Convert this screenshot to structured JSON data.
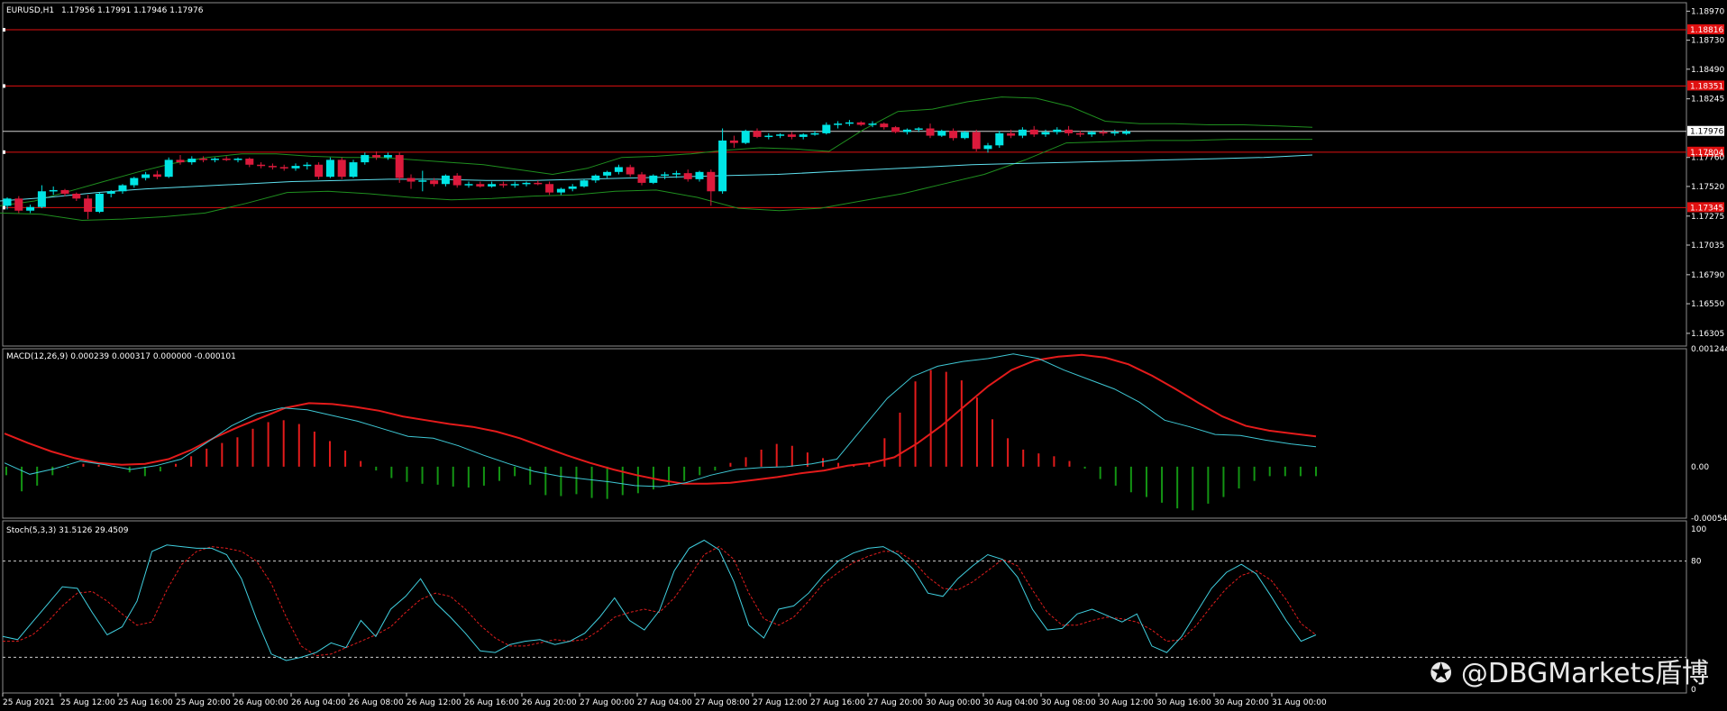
{
  "chart_data": [
    {
      "type": "candlestick",
      "title": "EURUSD,H1",
      "ohlc_text": "1.17956 1.17991 1.17946 1.17976",
      "ylim": [
        1.162,
        1.1904
      ],
      "yticks": [
        "1.18970",
        "1.18730",
        "1.18490",
        "1.18245",
        "1.17760",
        "1.17520",
        "1.17275",
        "1.17035",
        "1.16790",
        "1.16550",
        "1.16305"
      ],
      "current_price_label": "1.17976",
      "current_price": 1.17976,
      "horizontal_levels": [
        {
          "label": "1.18816",
          "value": 1.18816
        },
        {
          "label": "1.18351",
          "value": 1.18351
        },
        {
          "label": "1.17804",
          "value": 1.17804
        },
        {
          "label": "1.17345",
          "value": 1.17345
        }
      ],
      "candles": [
        [
          1.1736,
          1.1743,
          1.1733,
          1.1742
        ],
        [
          1.1742,
          1.1744,
          1.173,
          1.1732
        ],
        [
          1.1732,
          1.1737,
          1.173,
          1.1735
        ],
        [
          1.1735,
          1.1753,
          1.1734,
          1.1748
        ],
        [
          1.1748,
          1.1752,
          1.1745,
          1.1749
        ],
        [
          1.1749,
          1.175,
          1.1744,
          1.1746
        ],
        [
          1.1746,
          1.1747,
          1.174,
          1.1742
        ],
        [
          1.1742,
          1.1745,
          1.1725,
          1.1731
        ],
        [
          1.1731,
          1.1747,
          1.173,
          1.1746
        ],
        [
          1.1746,
          1.1749,
          1.1743,
          1.1748
        ],
        [
          1.1748,
          1.1754,
          1.1746,
          1.1753
        ],
        [
          1.1753,
          1.176,
          1.1751,
          1.1759
        ],
        [
          1.1759,
          1.1764,
          1.1757,
          1.1762
        ],
        [
          1.1762,
          1.1765,
          1.1758,
          1.176
        ],
        [
          1.176,
          1.1776,
          1.1759,
          1.1774
        ],
        [
          1.1774,
          1.1778,
          1.177,
          1.1772
        ],
        [
          1.1772,
          1.1777,
          1.177,
          1.1775
        ],
        [
          1.1775,
          1.1777,
          1.1772,
          1.1774
        ],
        [
          1.1774,
          1.1776,
          1.1772,
          1.1775
        ],
        [
          1.1775,
          1.1777,
          1.1773,
          1.1774
        ],
        [
          1.1774,
          1.1776,
          1.1772,
          1.1775
        ],
        [
          1.1775,
          1.1776,
          1.1768,
          1.177
        ],
        [
          1.177,
          1.1772,
          1.1767,
          1.1769
        ],
        [
          1.1769,
          1.1771,
          1.1766,
          1.1768
        ],
        [
          1.1768,
          1.177,
          1.1765,
          1.1767
        ],
        [
          1.1767,
          1.1771,
          1.1765,
          1.1769
        ],
        [
          1.1769,
          1.1772,
          1.1766,
          1.177
        ],
        [
          1.177,
          1.1772,
          1.1758,
          1.176
        ],
        [
          1.176,
          1.1776,
          1.1759,
          1.1774
        ],
        [
          1.1774,
          1.1776,
          1.1758,
          1.176
        ],
        [
          1.176,
          1.1774,
          1.1759,
          1.1772
        ],
        [
          1.1772,
          1.178,
          1.177,
          1.1778
        ],
        [
          1.1778,
          1.1781,
          1.1774,
          1.1776
        ],
        [
          1.1776,
          1.178,
          1.1774,
          1.1778
        ],
        [
          1.1778,
          1.178,
          1.1755,
          1.1759
        ],
        [
          1.1759,
          1.1762,
          1.175,
          1.1756
        ],
        [
          1.1756,
          1.1765,
          1.1748,
          1.1757
        ],
        [
          1.1757,
          1.1759,
          1.1752,
          1.1754
        ],
        [
          1.1754,
          1.1762,
          1.1752,
          1.1761
        ],
        [
          1.1761,
          1.1763,
          1.1751,
          1.1753
        ],
        [
          1.1753,
          1.1756,
          1.1751,
          1.1754
        ],
        [
          1.1754,
          1.1756,
          1.1751,
          1.1752
        ],
        [
          1.1752,
          1.1756,
          1.1751,
          1.1754
        ],
        [
          1.1754,
          1.1756,
          1.1751,
          1.1753
        ],
        [
          1.1753,
          1.1756,
          1.1751,
          1.1754
        ],
        [
          1.1754,
          1.1756,
          1.1752,
          1.1755
        ],
        [
          1.1755,
          1.1757,
          1.1753,
          1.1754
        ],
        [
          1.1754,
          1.1756,
          1.1745,
          1.1747
        ],
        [
          1.1747,
          1.1751,
          1.1745,
          1.175
        ],
        [
          1.175,
          1.1754,
          1.1748,
          1.1752
        ],
        [
          1.1752,
          1.1758,
          1.1751,
          1.1757
        ],
        [
          1.1757,
          1.1762,
          1.1755,
          1.1761
        ],
        [
          1.1761,
          1.1765,
          1.1759,
          1.1764
        ],
        [
          1.1764,
          1.177,
          1.1762,
          1.1768
        ],
        [
          1.1768,
          1.177,
          1.176,
          1.1762
        ],
        [
          1.1762,
          1.1764,
          1.1753,
          1.1755
        ],
        [
          1.1755,
          1.1762,
          1.1754,
          1.1761
        ],
        [
          1.1761,
          1.1764,
          1.1758,
          1.1762
        ],
        [
          1.1762,
          1.1765,
          1.1759,
          1.1763
        ],
        [
          1.1763,
          1.1766,
          1.1756,
          1.1758
        ],
        [
          1.1758,
          1.1765,
          1.1756,
          1.1764
        ],
        [
          1.1764,
          1.1766,
          1.1736,
          1.1748
        ],
        [
          1.1748,
          1.18,
          1.1746,
          1.179
        ],
        [
          1.179,
          1.1794,
          1.1784,
          1.1788
        ],
        [
          1.1788,
          1.1799,
          1.1787,
          1.1798
        ],
        [
          1.1798,
          1.18,
          1.1792,
          1.1793
        ],
        [
          1.1793,
          1.1796,
          1.1791,
          1.1794
        ],
        [
          1.1794,
          1.1796,
          1.1792,
          1.1795
        ],
        [
          1.1795,
          1.1797,
          1.1791,
          1.1793
        ],
        [
          1.1793,
          1.1796,
          1.1791,
          1.1795
        ],
        [
          1.1795,
          1.1798,
          1.1794,
          1.1796
        ],
        [
          1.1796,
          1.1805,
          1.1795,
          1.1803
        ],
        [
          1.1803,
          1.1806,
          1.18,
          1.1804
        ],
        [
          1.1804,
          1.1807,
          1.1802,
          1.1805
        ],
        [
          1.1805,
          1.1806,
          1.1802,
          1.1803
        ],
        [
          1.1803,
          1.1806,
          1.1801,
          1.1804
        ],
        [
          1.1804,
          1.1805,
          1.1799,
          1.1801
        ],
        [
          1.1801,
          1.1802,
          1.1796,
          1.1797
        ],
        [
          1.1797,
          1.18,
          1.1795,
          1.1799
        ],
        [
          1.1799,
          1.1801,
          1.1797,
          1.18
        ],
        [
          1.18,
          1.1804,
          1.1792,
          1.1794
        ],
        [
          1.1794,
          1.1799,
          1.1793,
          1.1798
        ],
        [
          1.1798,
          1.18,
          1.179,
          1.1792
        ],
        [
          1.1792,
          1.1798,
          1.1791,
          1.1797
        ],
        [
          1.1797,
          1.1799,
          1.1781,
          1.1783
        ],
        [
          1.1783,
          1.1788,
          1.178,
          1.1786
        ],
        [
          1.1786,
          1.1798,
          1.1784,
          1.1796
        ],
        [
          1.1796,
          1.1799,
          1.1792,
          1.1794
        ],
        [
          1.1794,
          1.1801,
          1.1792,
          1.1799
        ],
        [
          1.1799,
          1.1802,
          1.1793,
          1.1795
        ],
        [
          1.1795,
          1.1799,
          1.1793,
          1.1797
        ],
        [
          1.1797,
          1.1801,
          1.1795,
          1.1799
        ],
        [
          1.1799,
          1.1802,
          1.1794,
          1.1796
        ],
        [
          1.1796,
          1.1798,
          1.1793,
          1.1795
        ],
        [
          1.1795,
          1.1798,
          1.1793,
          1.1797
        ],
        [
          1.1797,
          1.1799,
          1.1794,
          1.1796
        ],
        [
          1.1796,
          1.1799,
          1.1794,
          1.1797
        ],
        [
          1.17956,
          1.17991,
          1.17946,
          1.17976
        ]
      ],
      "overlays": [
        {
          "name": "upper-band",
          "color": "#1f8f1f",
          "values": [
            1.1736,
            1.174,
            1.1748,
            1.1756,
            1.1764,
            1.1771,
            1.1776,
            1.1779,
            1.1779,
            1.1777,
            1.1776,
            1.1776,
            1.1774,
            1.1772,
            1.177,
            1.1766,
            1.1762,
            1.1767,
            1.1776,
            1.1777,
            1.1779,
            1.1782,
            1.1784,
            1.1783,
            1.1781,
            1.1799,
            1.1814,
            1.1816,
            1.1822,
            1.1826,
            1.1825,
            1.1818,
            1.1806,
            1.1804,
            1.1804,
            1.1803,
            1.1803,
            1.1802,
            1.1801
          ]
        },
        {
          "name": "lower-band",
          "color": "#1f8f1f",
          "values": [
            1.173,
            1.1729,
            1.1724,
            1.1725,
            1.1727,
            1.173,
            1.1738,
            1.1747,
            1.1748,
            1.1746,
            1.1743,
            1.1741,
            1.1742,
            1.1744,
            1.1745,
            1.1748,
            1.1749,
            1.1743,
            1.1734,
            1.1732,
            1.1734,
            1.174,
            1.1746,
            1.1754,
            1.1762,
            1.1774,
            1.1788,
            1.1789,
            1.179,
            1.179,
            1.1791,
            1.1791,
            1.1791
          ]
        },
        {
          "name": "middle-line",
          "color": "#5ee0ee",
          "values": [
            1.174,
            1.1743,
            1.1747,
            1.175,
            1.1752,
            1.1754,
            1.1756,
            1.1757,
            1.1758,
            1.1758,
            1.1757,
            1.1757,
            1.1758,
            1.1759,
            1.176,
            1.1761,
            1.1762,
            1.1764,
            1.1766,
            1.1768,
            1.177,
            1.1771,
            1.1772,
            1.1773,
            1.1774,
            1.1775,
            1.1776,
            1.1778
          ]
        }
      ]
    },
    {
      "type": "macd",
      "title": "MACD(12,26,9) 0.000239 0.000317 0.000000 -0.000101",
      "ylim": [
        -0.000543,
        0.001244
      ],
      "yticks": [
        "0.001244",
        "0.00",
        "-0.000543"
      ],
      "histogram": [
        -9e-05,
        -0.00026,
        -0.0002,
        -9e-05,
        -1e-05,
        3e-05,
        2e-05,
        1e-05,
        -6e-05,
        -0.0001,
        -5e-05,
        3e-05,
        0.00011,
        0.00019,
        0.00025,
        0.00031,
        0.0004,
        0.00047,
        0.00049,
        0.00045,
        0.00037,
        0.00027,
        0.00017,
        6e-05,
        -4e-05,
        -0.00012,
        -0.00016,
        -0.00018,
        -0.00019,
        -0.00021,
        -0.00022,
        -0.0002,
        -0.00015,
        -0.0001,
        -0.00019,
        -0.0003,
        -0.00031,
        -0.00029,
        -0.00033,
        -0.00034,
        -0.0003,
        -0.00028,
        -0.00024,
        -0.00019,
        -0.00015,
        -9e-05,
        -4e-05,
        4e-05,
        0.0001,
        0.00018,
        0.00024,
        0.00022,
        0.00015,
        9e-05,
        4e-05,
        2e-05,
        4e-05,
        0.0003,
        0.00057,
        0.0009,
        0.00102,
        0.001,
        0.00091,
        0.00073,
        0.0005,
        0.0003,
        0.00018,
        0.00014,
        0.00011,
        6e-05,
        -2e-05,
        -0.00013,
        -0.0002,
        -0.00027,
        -0.00032,
        -0.00038,
        -0.00044,
        -0.00046,
        -0.00039,
        -0.00032,
        -0.00023,
        -0.00015,
        -0.0001,
        -0.0001,
        -0.0001,
        -0.0001
      ],
      "signal": [
        0.00035,
        0.00025,
        0.00016,
        9e-05,
        4e-05,
        2e-05,
        3e-05,
        8e-05,
        0.00018,
        0.00031,
        0.00042,
        0.00052,
        0.00062,
        0.00067,
        0.00066,
        0.00063,
        0.00059,
        0.00053,
        0.00049,
        0.00045,
        0.00042,
        0.00037,
        0.0003,
        0.00021,
        0.00012,
        4e-05,
        -3e-05,
        -9e-05,
        -0.00014,
        -0.00018,
        -0.00018,
        -0.00017,
        -0.00014,
        -0.00011,
        -7e-05,
        -4e-05,
        1e-05,
        4e-05,
        0.0001,
        0.00025,
        0.00043,
        0.00064,
        0.00085,
        0.00102,
        0.00112,
        0.00116,
        0.00118,
        0.00115,
        0.00108,
        0.00096,
        0.00082,
        0.00067,
        0.00053,
        0.00043,
        0.00038,
        0.00035,
        0.00032
      ],
      "macd_line": [
        4e-05,
        -8e-05,
        -2e-05,
        6e-05,
        2e-05,
        -3e-05,
        1e-05,
        8e-05,
        0.00025,
        0.00043,
        0.00056,
        0.00062,
        0.0006,
        0.00054,
        0.00048,
        0.0004,
        0.00032,
        0.0003,
        0.00022,
        0.00012,
        3e-05,
        -5e-05,
        -0.0001,
        -0.00013,
        -0.00016,
        -0.0002,
        -0.00021,
        -0.00017,
        -9e-05,
        -3e-05,
        -1e-05,
        0.0,
        3e-05,
        8e-05,
        0.0004,
        0.00072,
        0.00095,
        0.00106,
        0.00111,
        0.00114,
        0.00119,
        0.00114,
        0.00102,
        0.00092,
        0.00082,
        0.00068,
        0.00049,
        0.00042,
        0.00034,
        0.00033,
        0.00028,
        0.00024,
        0.00021
      ]
    },
    {
      "type": "stochastic",
      "title": "Stoch(5,3,3) 31.5126 29.4509",
      "ylim": [
        0,
        100
      ],
      "yticks": [
        "100",
        "80",
        "0"
      ],
      "levels": [
        80,
        20
      ],
      "k": [
        33,
        31,
        42,
        53,
        64,
        63,
        48,
        34,
        39,
        55,
        86,
        90,
        89,
        88,
        88,
        84,
        69,
        44,
        22,
        18,
        20,
        23,
        29,
        26,
        43,
        33,
        50,
        58,
        69,
        54,
        45,
        35,
        24,
        23,
        28,
        30,
        31,
        28,
        30,
        35,
        45,
        57,
        43,
        37,
        49,
        74,
        88,
        93,
        87,
        67,
        40,
        32,
        50,
        52,
        60,
        71,
        80,
        85,
        88,
        89,
        84,
        75,
        60,
        58,
        69,
        77,
        84,
        81,
        70,
        50,
        37,
        38,
        47,
        50,
        46,
        42,
        47,
        27,
        23,
        33,
        48,
        63,
        73,
        78,
        72,
        58,
        43,
        30,
        34
      ],
      "d": [
        30,
        30,
        34,
        42,
        52,
        60,
        61,
        55,
        47,
        40,
        42,
        62,
        78,
        86,
        89,
        88,
        86,
        80,
        66,
        45,
        27,
        21,
        22,
        26,
        30,
        34,
        39,
        48,
        56,
        60,
        58,
        50,
        40,
        32,
        27,
        27,
        29,
        31,
        30,
        31,
        37,
        45,
        48,
        50,
        48,
        57,
        70,
        84,
        89,
        81,
        60,
        44,
        40,
        45,
        55,
        66,
        73,
        79,
        83,
        86,
        86,
        80,
        70,
        63,
        62,
        67,
        74,
        81,
        77,
        62,
        48,
        40,
        40,
        43,
        45,
        44,
        42,
        37,
        30,
        31,
        40,
        52,
        63,
        71,
        74,
        68,
        56,
        41,
        34
      ],
      "x_labels": [
        "25 Aug 2021",
        "25 Aug 12:00",
        "25 Aug 16:00",
        "25 Aug 20:00",
        "26 Aug 00:00",
        "26 Aug 04:00",
        "26 Aug 08:00",
        "26 Aug 12:00",
        "26 Aug 16:00",
        "26 Aug 20:00",
        "27 Aug 00:00",
        "27 Aug 04:00",
        "27 Aug 08:00",
        "27 Aug 12:00",
        "27 Aug 16:00",
        "27 Aug 20:00",
        "30 Aug 00:00",
        "30 Aug 04:00",
        "30 Aug 08:00",
        "30 Aug 12:00",
        "30 Aug 16:00",
        "30 Aug 20:00",
        "31 Aug 00:00"
      ]
    }
  ],
  "watermark": "@DBGMarkets盾博",
  "colors": {
    "bull": "#00e5e5",
    "bear": "#dc1a3c",
    "level": "#e01010",
    "grid_dashed": "#cfcfcf",
    "macd_signal": "#e41b1b",
    "macd_line": "#3ec7d4",
    "hist_pos": "#e41b1b",
    "hist_neg": "#139413",
    "stoch_k": "#40d0e0",
    "stoch_d": "#e11d1d"
  }
}
